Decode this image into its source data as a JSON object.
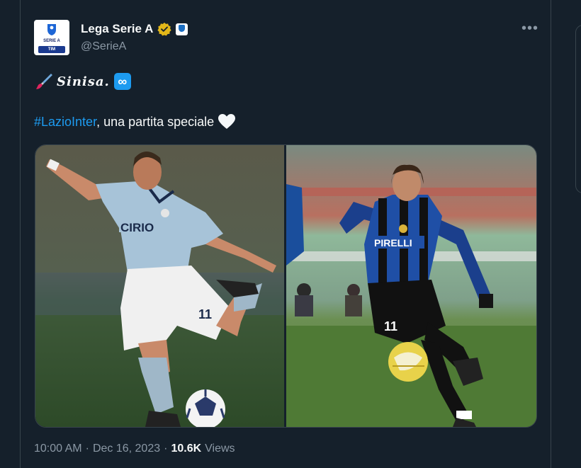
{
  "account": {
    "display_name": "Lega Serie A",
    "handle": "@SerieA",
    "avatar_text_top": "SERIE A",
    "avatar_text_bottom": "TIM"
  },
  "tweet": {
    "line1_text": "Sinisa.",
    "hashtag": "#LazioInter",
    "line2_rest": ", una partita speciale",
    "media": [
      {
        "label": "CIRIO",
        "number": "11"
      },
      {
        "label": "PIRELLI",
        "number": "11"
      }
    ]
  },
  "footer": {
    "time": "10:00 AM",
    "separator": "·",
    "date": "Dec 16, 2023",
    "views_count": "10.6K",
    "views_label": "Views"
  },
  "colors": {
    "background": "#15202b",
    "accent": "#1d9bf0",
    "verified_gold": "#e2b719",
    "muted_text": "#8b98a5"
  }
}
